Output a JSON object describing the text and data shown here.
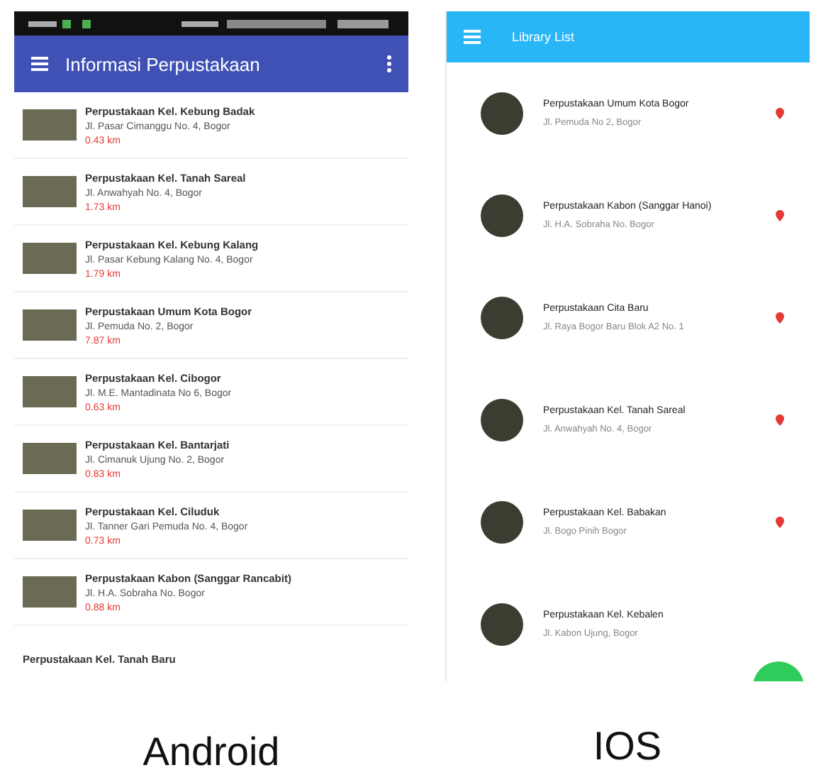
{
  "android": {
    "app_bar": {
      "title": "Informasi Perpustakaan"
    },
    "items": [
      {
        "name": "Perpustakaan Kel. Kebung Badak",
        "address": "Jl. Pasar Cimanggu No. 4, Bogor",
        "distance": "0.43 km"
      },
      {
        "name": "Perpustakaan Kel. Tanah Sareal",
        "address": "Jl. Anwahyah No. 4, Bogor",
        "distance": "1.73 km"
      },
      {
        "name": "Perpustakaan Kel. Kebung Kalang",
        "address": "Jl. Pasar Kebung Kalang No. 4, Bogor",
        "distance": "1.79 km"
      },
      {
        "name": "Perpustakaan Umum Kota Bogor",
        "address": "Jl. Pemuda No. 2, Bogor",
        "distance": "7.87 km"
      },
      {
        "name": "Perpustakaan Kel. Cibogor",
        "address": "Jl. M.E. Mantadinata No 6, Bogor",
        "distance": "0.63 km"
      },
      {
        "name": "Perpustakaan Kel. Bantarjati",
        "address": "Jl. Cimanuk Ujung No. 2, Bogor",
        "distance": "0.83 km"
      },
      {
        "name": "Perpustakaan Kel. Ciluduk",
        "address": "Jl. Tanner Gari Pemuda No. 4, Bogor",
        "distance": "0.73 km"
      },
      {
        "name": "Perpustakaan Kabon (Sanggar Rancabit)",
        "address": "Jl. H.A. Sobraha No. Bogor",
        "distance": "0.88 km"
      },
      {
        "name": "Perpustakaan Kel. Tanah Baru"
      }
    ],
    "caption": "Android"
  },
  "ios": {
    "nav_bar": {
      "title": "Library List"
    },
    "items": [
      {
        "name": "Perpustakaan Umum Kota Bogor",
        "address": "Jl. Pemuda No 2, Bogor"
      },
      {
        "name": "Perpustakaan Kabon (Sanggar Hanoi)",
        "address": "Jl. H.A. Sobraha No. Bogor"
      },
      {
        "name": "Perpustakaan Cita Baru",
        "address": "Jl. Raya Bogor Baru Blok A2 No. 1"
      },
      {
        "name": "Perpustakaan Kel. Tanah Sareal",
        "address": "Jl. Anwahyah No. 4, Bogor"
      },
      {
        "name": "Perpustakaan Kel. Babakan",
        "address": "Jl. Bogo Pinih Bogor"
      },
      {
        "name": "Perpustakaan Kel. Kebalen",
        "address": "Jl. Kabon Ujung, Bogor"
      }
    ],
    "caption": "IOS"
  }
}
